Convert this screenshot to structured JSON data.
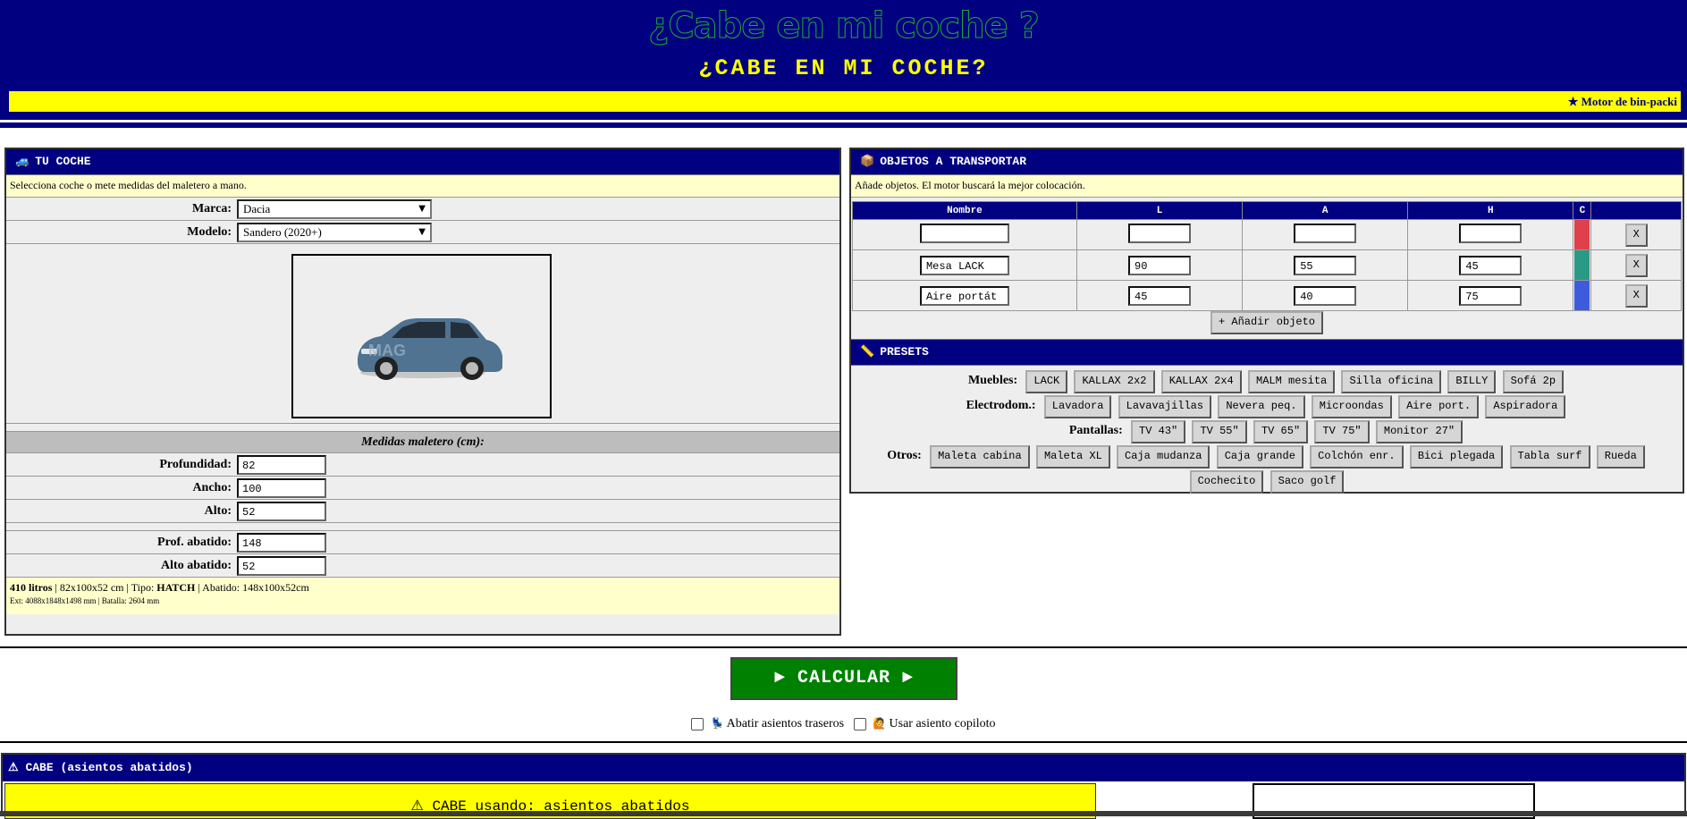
{
  "header": {
    "logo_text": "¿Cabe en mi coche ?",
    "subtitle": "¿CABE EN MI COCHE?",
    "marquee": "★ Motor de bin-packi"
  },
  "car_panel": {
    "title": "TU COCHE",
    "title_icon": "car-icon",
    "hint": "Selecciona coche o mete medidas del maletero a mano.",
    "brand_label": "Marca:",
    "brand_value": "Dacia",
    "model_label": "Modelo:",
    "model_value": "Sandero (2020+)",
    "car_image_alt": "MAG",
    "trunk_heading": "Medidas maletero (cm):",
    "depth_label": "Profundidad:",
    "depth_value": "82",
    "width_label": "Ancho:",
    "width_value": "100",
    "height_label": "Alto:",
    "height_value": "52",
    "folded_depth_label": "Prof. abatido:",
    "folded_depth_value": "148",
    "folded_height_label": "Alto abatido:",
    "folded_height_value": "52",
    "summary_liters": "410 litros",
    "summary_rest": " | 82x100x52 cm | Tipo: ",
    "summary_type": "HATCH",
    "summary_folded": " | Abatido: 148x100x52cm",
    "summary_ext": "Ext: 4088x1848x1498 mm | Batalla: 2604 mm"
  },
  "objects_panel": {
    "title": "OBJETOS A TRANSPORTAR",
    "title_icon": "box-icon",
    "hint": "Añade objetos. El motor buscará la mejor colocación.",
    "columns": [
      "Nombre",
      "L",
      "A",
      "H",
      "C"
    ],
    "rows": [
      {
        "name": "",
        "l": "",
        "a": "",
        "h": "",
        "color": "#e0404a",
        "remove": "X"
      },
      {
        "name": "Mesa LACK",
        "l": "90",
        "a": "55",
        "h": "45",
        "color": "#2a9a87",
        "remove": "X"
      },
      {
        "name": "Aire portát",
        "l": "45",
        "a": "40",
        "h": "75",
        "color": "#3d5bdc",
        "remove": "X"
      }
    ],
    "add_button": "+ Añadir objeto"
  },
  "presets": {
    "title": "PRESETS",
    "title_icon": "ruler-icon",
    "muebles_label": "Muebles:",
    "muebles": [
      "LACK",
      "KALLAX 2x2",
      "KALLAX 2x4",
      "MALM mesita",
      "Silla oficina",
      "BILLY",
      "Sofá 2p"
    ],
    "electro_label": "Electrodom.:",
    "electro": [
      "Lavadora",
      "Lavavajillas",
      "Nevera peq.",
      "Microondas",
      "Aire port.",
      "Aspiradora"
    ],
    "pantallas_label": "Pantallas:",
    "pantallas": [
      "TV 43\"",
      "TV 55\"",
      "TV 65\"",
      "TV 75\"",
      "Monitor 27\""
    ],
    "otros_label": "Otros:",
    "otros": [
      "Maleta cabina",
      "Maleta XL",
      "Caja mudanza",
      "Caja grande",
      "Colchón enr.",
      "Bici plegada",
      "Tabla surf",
      "Rueda"
    ],
    "otros2": [
      "Cochecito",
      "Saco golf"
    ]
  },
  "actions": {
    "calculate": "► CALCULAR ►",
    "fold_seats": "Abatir asientos traseros",
    "fold_icon": "seat-icon",
    "copilot_seat": "Usar asiento copiloto",
    "copilot_icon": "person-icon"
  },
  "result": {
    "title": "⚠ CABE (asientos abatidos)",
    "banner": "⚠ CABE usando: asientos abatidos"
  },
  "colors": {
    "navy": "#000080",
    "yellow": "#ffff00",
    "green": "#008000",
    "light_yellow": "#ffffcc"
  }
}
